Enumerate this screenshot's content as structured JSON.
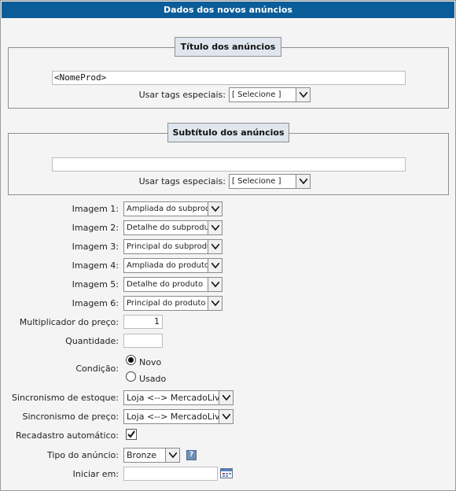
{
  "header": {
    "title": "Dados dos novos anúncios"
  },
  "titulo": {
    "legend": "Título dos anúncios",
    "value": "<NomeProd>",
    "tags_label": "Usar tags especiais:",
    "tags_select": "[ Selecione ]"
  },
  "subtitulo": {
    "legend": "Subtítulo dos anúncios",
    "value": "",
    "tags_label": "Usar tags especiais:",
    "tags_select": "[ Selecione ]"
  },
  "imagens": [
    {
      "label": "Imagem 1:",
      "value": "Ampliada do subproduto"
    },
    {
      "label": "Imagem 2:",
      "value": "Detalhe do subproduto"
    },
    {
      "label": "Imagem 3:",
      "value": "Principal do subproduto"
    },
    {
      "label": "Imagem 4:",
      "value": "Ampliada do produto"
    },
    {
      "label": "Imagem 5:",
      "value": "Detalhe do produto"
    },
    {
      "label": "Imagem 6:",
      "value": "Principal do produto"
    }
  ],
  "multiplicador": {
    "label": "Multiplicador do preço:",
    "value": "1"
  },
  "quantidade": {
    "label": "Quantidade:",
    "value": ""
  },
  "condicao": {
    "label": "Condição:",
    "options": [
      "Novo",
      "Usado"
    ],
    "selected": "Novo"
  },
  "sinc_estoque": {
    "label": "Sincronismo de estoque:",
    "value": "Loja <--> MercadoLivre"
  },
  "sinc_preco": {
    "label": "Sincronismo de preço:",
    "value": "Loja <--> MercadoLivre"
  },
  "recadastro": {
    "label": "Recadastro automático:",
    "checked": true
  },
  "tipo_anuncio": {
    "label": "Tipo do anúncio:",
    "value": "Bronze",
    "help_icon": "?"
  },
  "iniciar": {
    "label": "Iniciar em:",
    "value": "",
    "icon": "calendar-icon"
  },
  "colors": {
    "header_bg": "#0b5d99",
    "legend_bg": "#dfe6ee",
    "panel_bg": "#f4f4f4"
  }
}
